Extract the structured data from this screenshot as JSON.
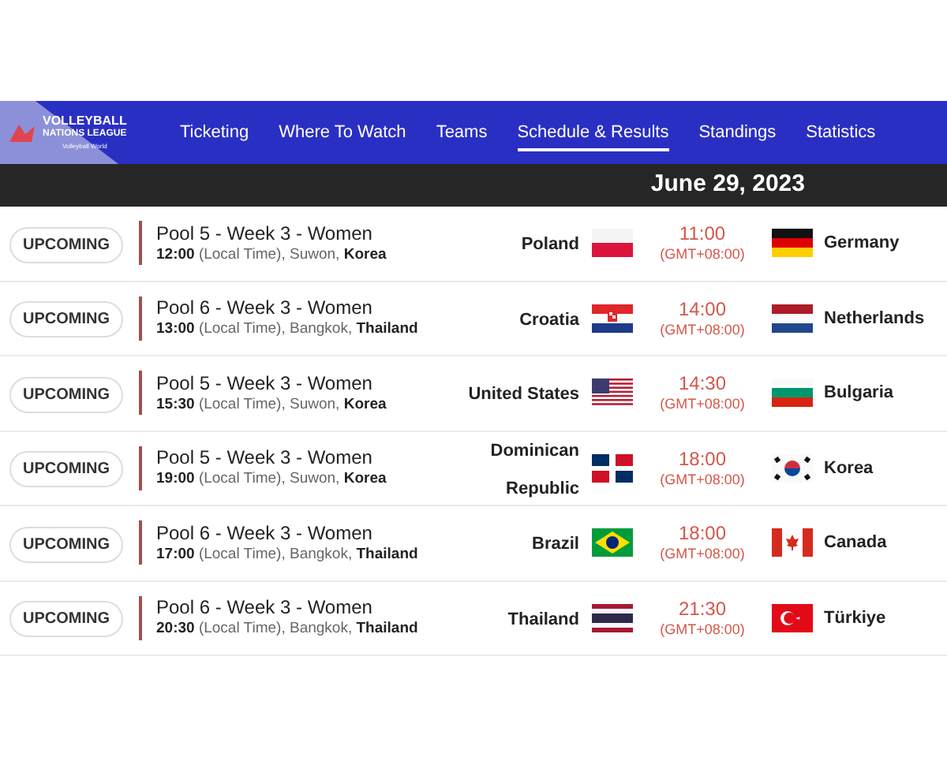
{
  "logo": {
    "title": "VOLLEYBALL",
    "subtitle": "NATIONS LEAGUE",
    "brand": "Volleyball World"
  },
  "nav": [
    {
      "label": "Ticketing",
      "selected": false
    },
    {
      "label": "Where To Watch",
      "selected": false
    },
    {
      "label": "Teams",
      "selected": false
    },
    {
      "label": "Schedule & Results",
      "selected": true
    },
    {
      "label": "Standings",
      "selected": false
    },
    {
      "label": "Statistics",
      "selected": false
    }
  ],
  "date": "June 29, 2023",
  "matches": [
    {
      "status": "UPCOMING",
      "title": "Pool 5 - Week 3 - Women",
      "details": "**12:00** (Local Time), Suwon, **Korea**",
      "home": "Poland",
      "time": "11:00",
      "timezone": "(GMT+08:00)",
      "away": "Germany"
    },
    {
      "status": "UPCOMING",
      "title": "Pool 6 - Week 3 - Women",
      "details": "**13:00** (Local Time), Bangkok, **Thailand**",
      "home": "Croatia",
      "time": "14:00",
      "timezone": "(GMT+08:00)",
      "away": "Netherlands"
    },
    {
      "status": "UPCOMING",
      "title": "Pool 5 - Week 3 - Women",
      "details": "**15:30** (Local Time), Suwon, **Korea**",
      "home": "United States",
      "time": "14:30",
      "timezone": "(GMT+08:00)",
      "away": "Bulgaria"
    },
    {
      "status": "UPCOMING",
      "title": "Pool 5 - Week 3 - Women",
      "details": "**19:00** (Local Time), Suwon, **Korea**",
      "home": "Dominican Republic",
      "time": "18:00",
      "timezone": "(GMT+08:00)",
      "away": "Korea"
    },
    {
      "status": "UPCOMING",
      "title": "Pool 6 - Week 3 - Women",
      "details": "**17:00** (Local Time), Bangkok, **Thailand**",
      "home": "Brazil",
      "time": "18:00",
      "timezone": "(GMT+08:00)",
      "away": "Canada"
    },
    {
      "status": "UPCOMING",
      "title": "Pool 6 - Week 3 - Women",
      "details": "**20:30** (Local Time), Bangkok, **Thailand**",
      "home": "Thailand",
      "time": "21:30",
      "timezone": "(GMT+08:00)",
      "away": "Türkiye"
    }
  ]
}
